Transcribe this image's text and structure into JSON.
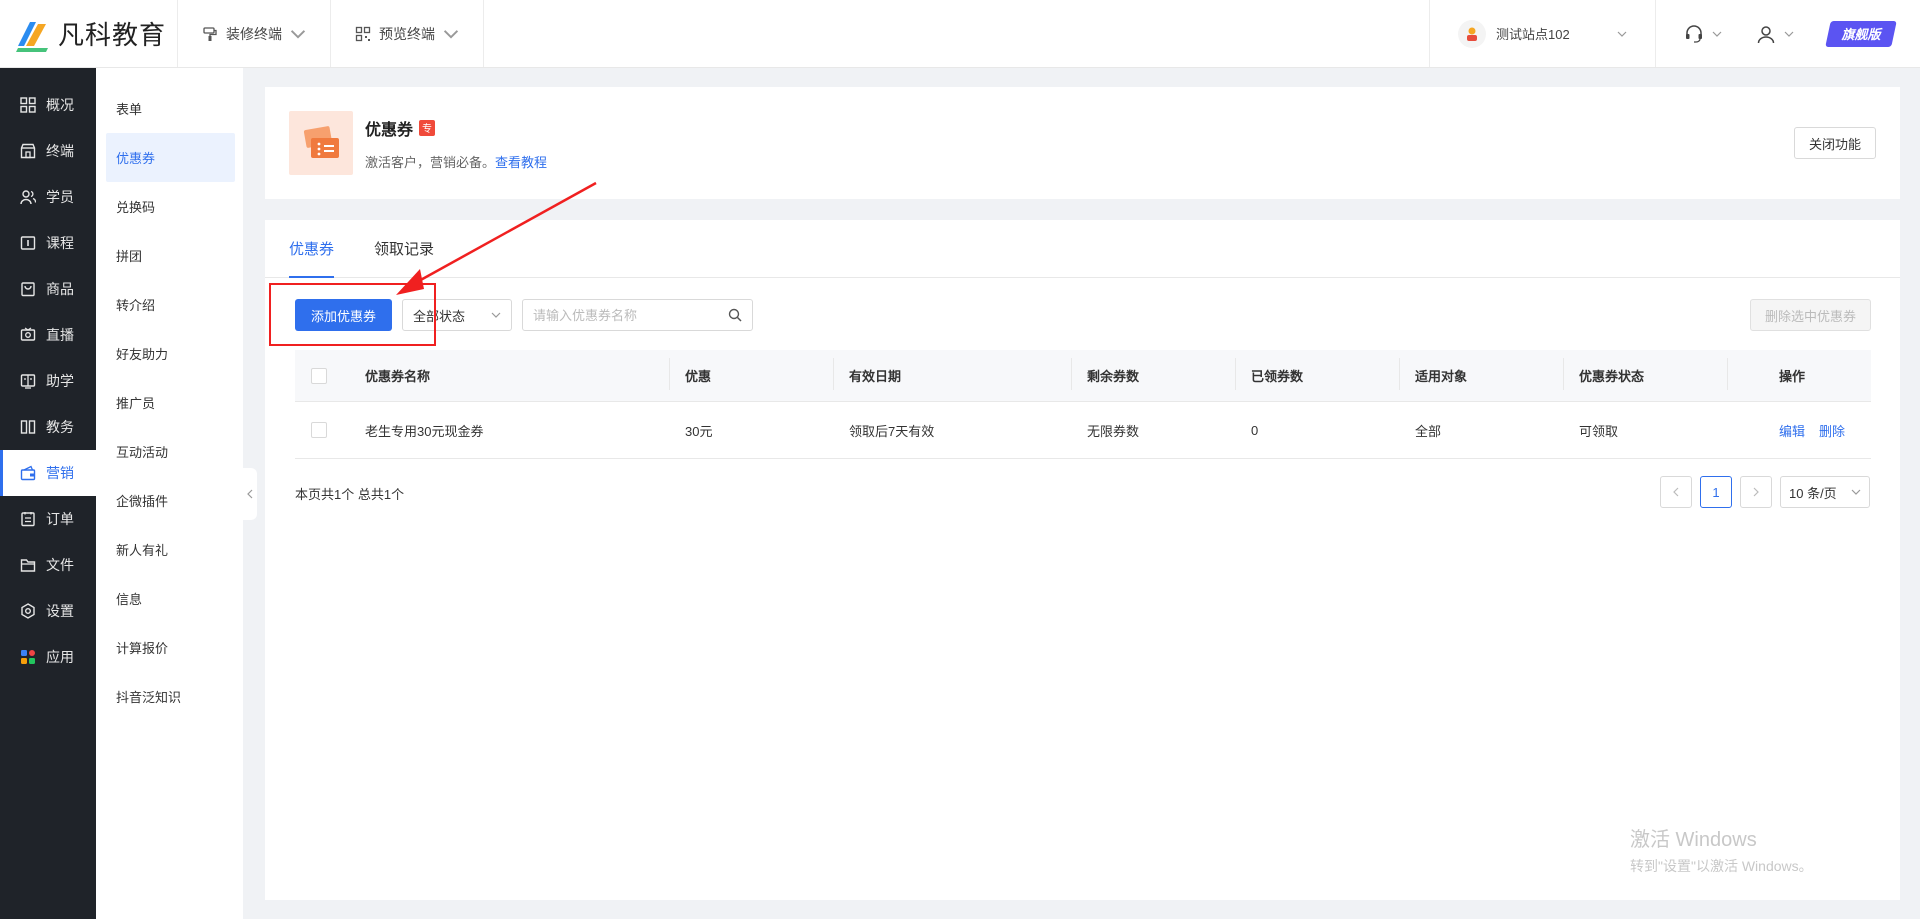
{
  "brand": {
    "name": "凡科教育"
  },
  "header": {
    "decorate_label": "装修终端",
    "preview_label": "预览终端",
    "site_label": "测试站点102",
    "badge_label": "旗舰版"
  },
  "nav": {
    "items": [
      {
        "label": "概况",
        "icon": "grid-icon"
      },
      {
        "label": "终端",
        "icon": "store-icon"
      },
      {
        "label": "学员",
        "icon": "users-icon"
      },
      {
        "label": "课程",
        "icon": "course-icon"
      },
      {
        "label": "商品",
        "icon": "bag-icon"
      },
      {
        "label": "直播",
        "icon": "live-icon"
      },
      {
        "label": "助学",
        "icon": "book-icon"
      },
      {
        "label": "教务",
        "icon": "columns-icon"
      },
      {
        "label": "营销",
        "icon": "marketing-icon"
      },
      {
        "label": "订单",
        "icon": "order-icon"
      },
      {
        "label": "文件",
        "icon": "folder-icon"
      },
      {
        "label": "设置",
        "icon": "settings-icon"
      },
      {
        "label": "应用",
        "icon": "apps-icon"
      }
    ],
    "active": "营销"
  },
  "subnav": {
    "items": [
      "表单",
      "优惠券",
      "兑换码",
      "拼团",
      "转介绍",
      "好友助力",
      "推广员",
      "互动活动",
      "企微插件",
      "新人有礼",
      "信息",
      "计算报价",
      "抖音泛知识"
    ],
    "active": "优惠券"
  },
  "feature": {
    "title": "优惠券",
    "tag": "专",
    "desc": "激活客户，营销必备。",
    "tutorial_link": "查看教程",
    "close_label": "关闭功能"
  },
  "tabs": [
    {
      "label": "优惠券",
      "active": true
    },
    {
      "label": "领取记录",
      "active": false
    }
  ],
  "toolbar": {
    "add_label": "添加优惠券",
    "status_filter": "全部状态",
    "search_placeholder": "请输入优惠券名称",
    "delete_label": "删除选中优惠券"
  },
  "table": {
    "headers": [
      "优惠券名称",
      "优惠",
      "有效日期",
      "剩余券数",
      "已领券数",
      "适用对象",
      "优惠券状态",
      "操作"
    ],
    "rows": [
      {
        "name": "老生专用30元现金券",
        "discount": "30元",
        "valid": "领取后7天有效",
        "remaining": "无限券数",
        "claimed": "0",
        "target": "全部",
        "status": "可领取",
        "edit": "编辑",
        "delete": "删除"
      }
    ]
  },
  "pagination": {
    "info": "本页共1个 总共1个",
    "current": "1",
    "page_size": "10 条/页"
  },
  "watermark": {
    "line1": "激活 Windows",
    "line2": "转到\"设置\"以激活 Windows。"
  },
  "colors": {
    "primary": "#2f6fed",
    "sidebar": "#1f2329",
    "highlight": "#f02020",
    "tag": "#f04a3a"
  }
}
